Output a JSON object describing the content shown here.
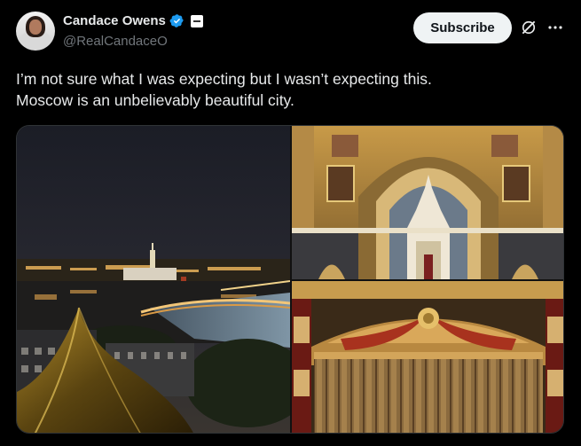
{
  "author": {
    "display_name": "Candace Owens",
    "handle": "@RealCandaceO",
    "verified_icon": "verified-badge-icon",
    "affiliate_icon": "affiliate-badge-icon"
  },
  "actions": {
    "subscribe_label": "Subscribe",
    "grok_icon": "grok-icon",
    "more_icon": "more-icon"
  },
  "tweet": {
    "text_line1": "I’m not sure what I was expecting but I wasn’t expecting this.",
    "text_line2": "Moscow is an unbelievably beautiful city."
  },
  "media": {
    "photos": [
      {
        "name": "moscow-night-skyline-photo"
      },
      {
        "name": "cathedral-interior-photo"
      },
      {
        "name": "theater-curtain-photo"
      }
    ]
  },
  "colors": {
    "background": "#000000",
    "text": "#e7e9ea",
    "muted": "#71767b",
    "verified": "#1d9bf0",
    "button_bg": "#eff3f4"
  }
}
